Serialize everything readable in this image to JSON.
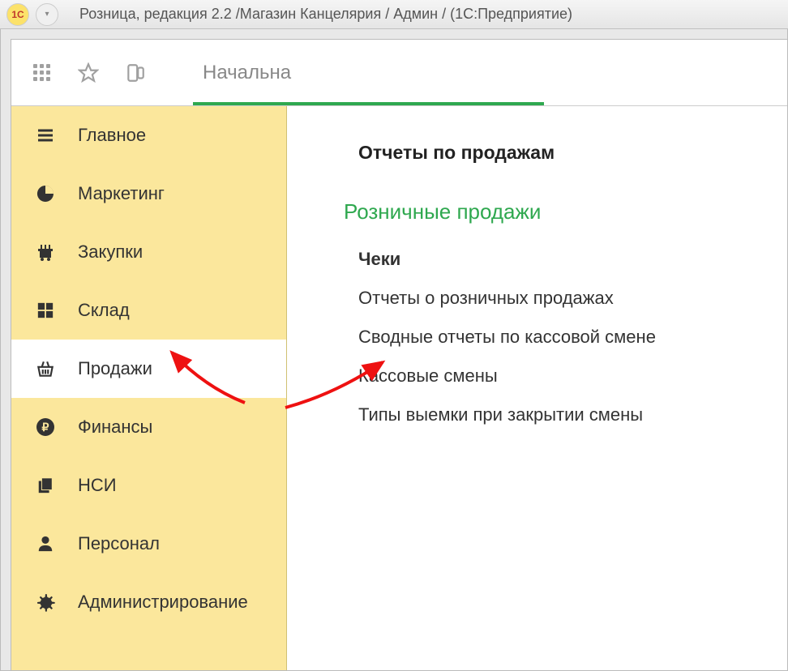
{
  "window": {
    "title": "Розница, редакция 2.2 /Магазин Канцелярия / Админ /  (1С:Предприятие)"
  },
  "toolbar": {
    "tab_label": "Начальна"
  },
  "sidebar": {
    "items": [
      {
        "label": "Главное"
      },
      {
        "label": "Маркетинг"
      },
      {
        "label": "Закупки"
      },
      {
        "label": "Склад"
      },
      {
        "label": "Продажи"
      },
      {
        "label": "Финансы"
      },
      {
        "label": "НСИ"
      },
      {
        "label": "Персонал"
      },
      {
        "label": "Администрирование"
      }
    ],
    "active_index": 4
  },
  "content": {
    "heading": "Отчеты по продажам",
    "section": "Розничные продажи",
    "items": [
      {
        "label": "Чеки",
        "bold": true
      },
      {
        "label": "Отчеты о розничных продажах"
      },
      {
        "label": "Сводные отчеты по кассовой смене"
      },
      {
        "label": "Кассовые смены"
      },
      {
        "label": "Типы выемки при закрытии смены"
      }
    ]
  },
  "colors": {
    "accent_green": "#2fa84f",
    "sidebar_bg": "#fbe79c",
    "annotation": "#e11"
  }
}
